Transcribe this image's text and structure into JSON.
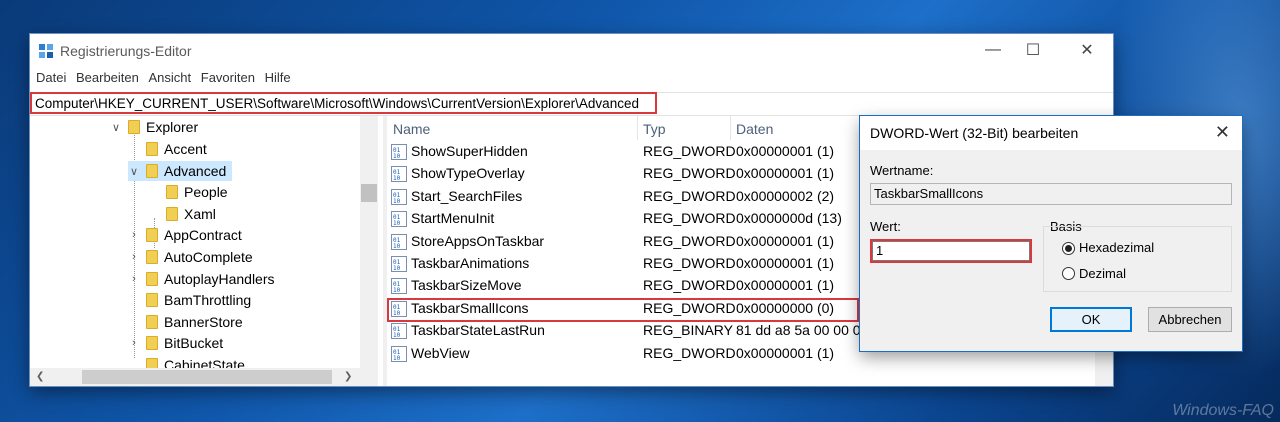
{
  "window": {
    "title": "Registrierungs-Editor",
    "minimize": "—",
    "maximize": "☐",
    "close": "✕"
  },
  "menu": [
    "Datei",
    "Bearbeiten",
    "Ansicht",
    "Favoriten",
    "Hilfe"
  ],
  "address": "Computer\\HKEY_CURRENT_USER\\Software\\Microsoft\\Windows\\CurrentVersion\\Explorer\\Advanced",
  "tree": [
    {
      "label": "Explorer",
      "expanded": true
    },
    {
      "label": "Accent"
    },
    {
      "label": "Advanced",
      "expanded": true,
      "selected": true
    },
    {
      "label": "People"
    },
    {
      "label": "Xaml"
    },
    {
      "label": "AppContract"
    },
    {
      "label": "AutoComplete"
    },
    {
      "label": "AutoplayHandlers"
    },
    {
      "label": "BamThrottling"
    },
    {
      "label": "BannerStore"
    },
    {
      "label": "BitBucket"
    },
    {
      "label": "CabinetState"
    }
  ],
  "columns": {
    "name": "Name",
    "type": "Typ",
    "data": "Daten"
  },
  "values": [
    {
      "name": "ShowSuperHidden",
      "type": "REG_DWORD",
      "data": "0x00000001 (1)"
    },
    {
      "name": "ShowTypeOverlay",
      "type": "REG_DWORD",
      "data": "0x00000001 (1)"
    },
    {
      "name": "Start_SearchFiles",
      "type": "REG_DWORD",
      "data": "0x00000002 (2)"
    },
    {
      "name": "StartMenuInit",
      "type": "REG_DWORD",
      "data": "0x0000000d (13)"
    },
    {
      "name": "StoreAppsOnTaskbar",
      "type": "REG_DWORD",
      "data": "0x00000001 (1)"
    },
    {
      "name": "TaskbarAnimations",
      "type": "REG_DWORD",
      "data": "0x00000001 (1)"
    },
    {
      "name": "TaskbarSizeMove",
      "type": "REG_DWORD",
      "data": "0x00000001 (1)"
    },
    {
      "name": "TaskbarSmallIcons",
      "type": "REG_DWORD",
      "data": "0x00000000 (0)"
    },
    {
      "name": "TaskbarStateLastRun",
      "type": "REG_BINARY",
      "data": "81 dd a8 5a 00 00 0"
    },
    {
      "name": "WebView",
      "type": "REG_DWORD",
      "data": "0x00000001 (1)"
    }
  ],
  "dialog": {
    "title": "DWORD-Wert (32-Bit) bearbeiten",
    "close": "✕",
    "value_name_label": "Wertname:",
    "value_name": "TaskbarSmallIcons",
    "value_label": "Wert:",
    "value": "1",
    "base_label": "Basis",
    "hex_label": "Hexadezimal",
    "dec_label": "Dezimal",
    "ok": "OK",
    "cancel": "Abbrechen"
  },
  "watermark": "Windows-FAQ",
  "colors": {
    "highlight": "#d9383f",
    "selection": "#cce8ff",
    "folder": "#f1cf55"
  }
}
